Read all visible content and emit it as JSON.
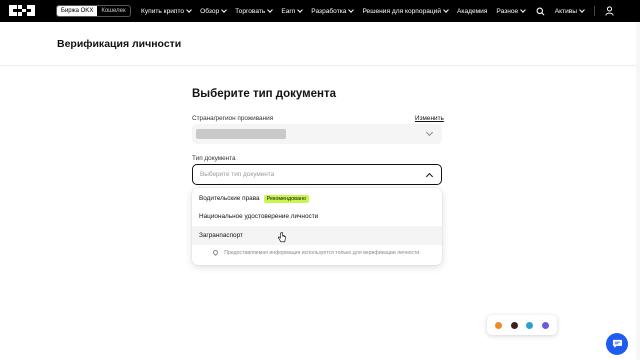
{
  "topbar": {
    "mode_tabs": [
      "Биржа OKX",
      "Кошелек"
    ],
    "nav": [
      {
        "label": "Купить крипто",
        "has_chevron": true
      },
      {
        "label": "Обзор",
        "has_chevron": true
      },
      {
        "label": "Торговать",
        "has_chevron": true
      },
      {
        "label": "Earn",
        "has_chevron": true
      },
      {
        "label": "Разработка",
        "has_chevron": true
      },
      {
        "label": "Решения для корпораций",
        "has_chevron": true
      },
      {
        "label": "Академия",
        "has_chevron": false
      },
      {
        "label": "Разное",
        "has_chevron": true
      }
    ],
    "assets_label": "Активы"
  },
  "header": {
    "title": "Верификация личности"
  },
  "form": {
    "title": "Выберите тип документа",
    "country_label": "Страна/регион проживания",
    "edit_link": "Изменить",
    "doc_type_label": "Тип документа",
    "doc_placeholder": "Выберите тип документа"
  },
  "dropdown": {
    "options": [
      {
        "label": "Водительские права",
        "badge": "Рекомендовано"
      },
      {
        "label": "Национальное удостоверение личности",
        "badge": ""
      },
      {
        "label": "Загранпаспорт",
        "badge": ""
      }
    ],
    "note": "Предоставляемая информация используется только для верификации личности."
  },
  "colors": {
    "topbar": "#000000",
    "badge": "#c8f550",
    "chat": "#1e5cf0"
  },
  "icons": [
    "okx-logo",
    "search-icon",
    "user-icon",
    "globe-icon",
    "chat-icon",
    "location-pin-icon"
  ]
}
